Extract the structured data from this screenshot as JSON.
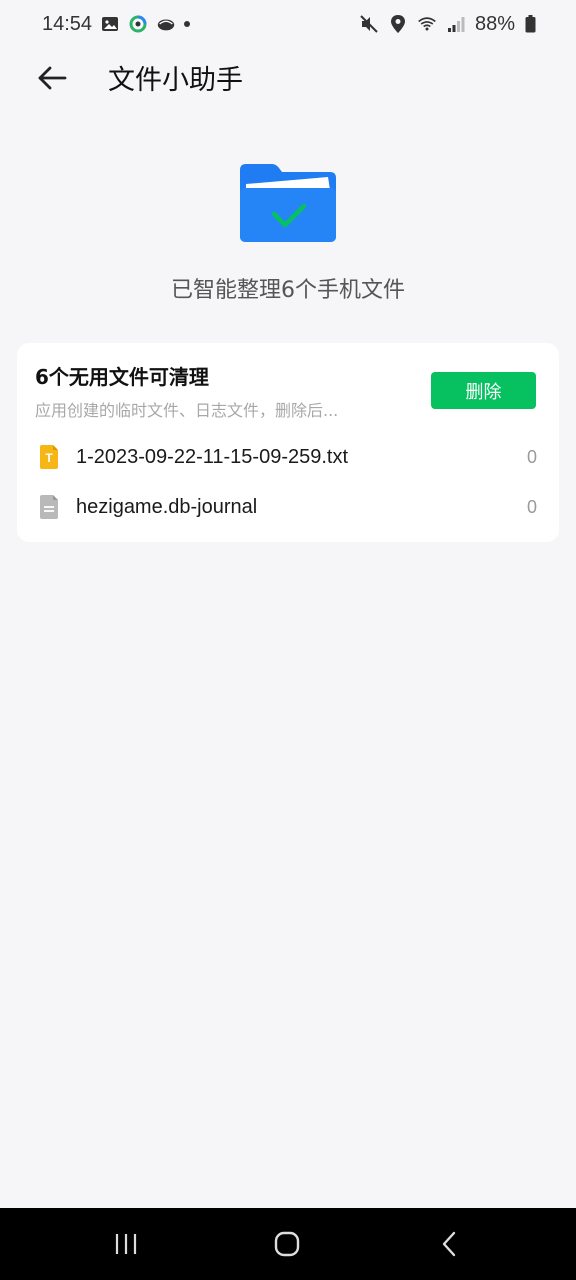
{
  "status_bar": {
    "time": "14:54",
    "left_icons": [
      "gallery-icon",
      "app-circle-icon",
      "cloud-bird-icon",
      "notification-dot-icon"
    ],
    "right_icons": [
      "mute-icon",
      "location-icon",
      "wifi-icon",
      "signal-icon"
    ],
    "battery": "88%"
  },
  "header": {
    "title": "文件小助手",
    "back_icon": "arrow-left-icon"
  },
  "hero": {
    "icon": "folder-check-icon",
    "text": "已智能整理6个手机文件",
    "colors": {
      "folder": "#1f7cf2",
      "check": "#07c160"
    }
  },
  "card": {
    "title": "6个无用文件可清理",
    "subtitle": "应用创建的临时文件、日志文件，删除后...",
    "delete_label": "删除",
    "accent": "#07c160",
    "files": [
      {
        "name": "1-2023-09-22-11-15-09-259.txt",
        "size": "0",
        "icon": "text-file-icon"
      },
      {
        "name": "hezigame.db-journal",
        "size": "0",
        "icon": "generic-file-icon"
      }
    ]
  },
  "nav_bar": {
    "buttons": [
      "recent-apps-icon",
      "home-icon",
      "back-icon"
    ]
  }
}
